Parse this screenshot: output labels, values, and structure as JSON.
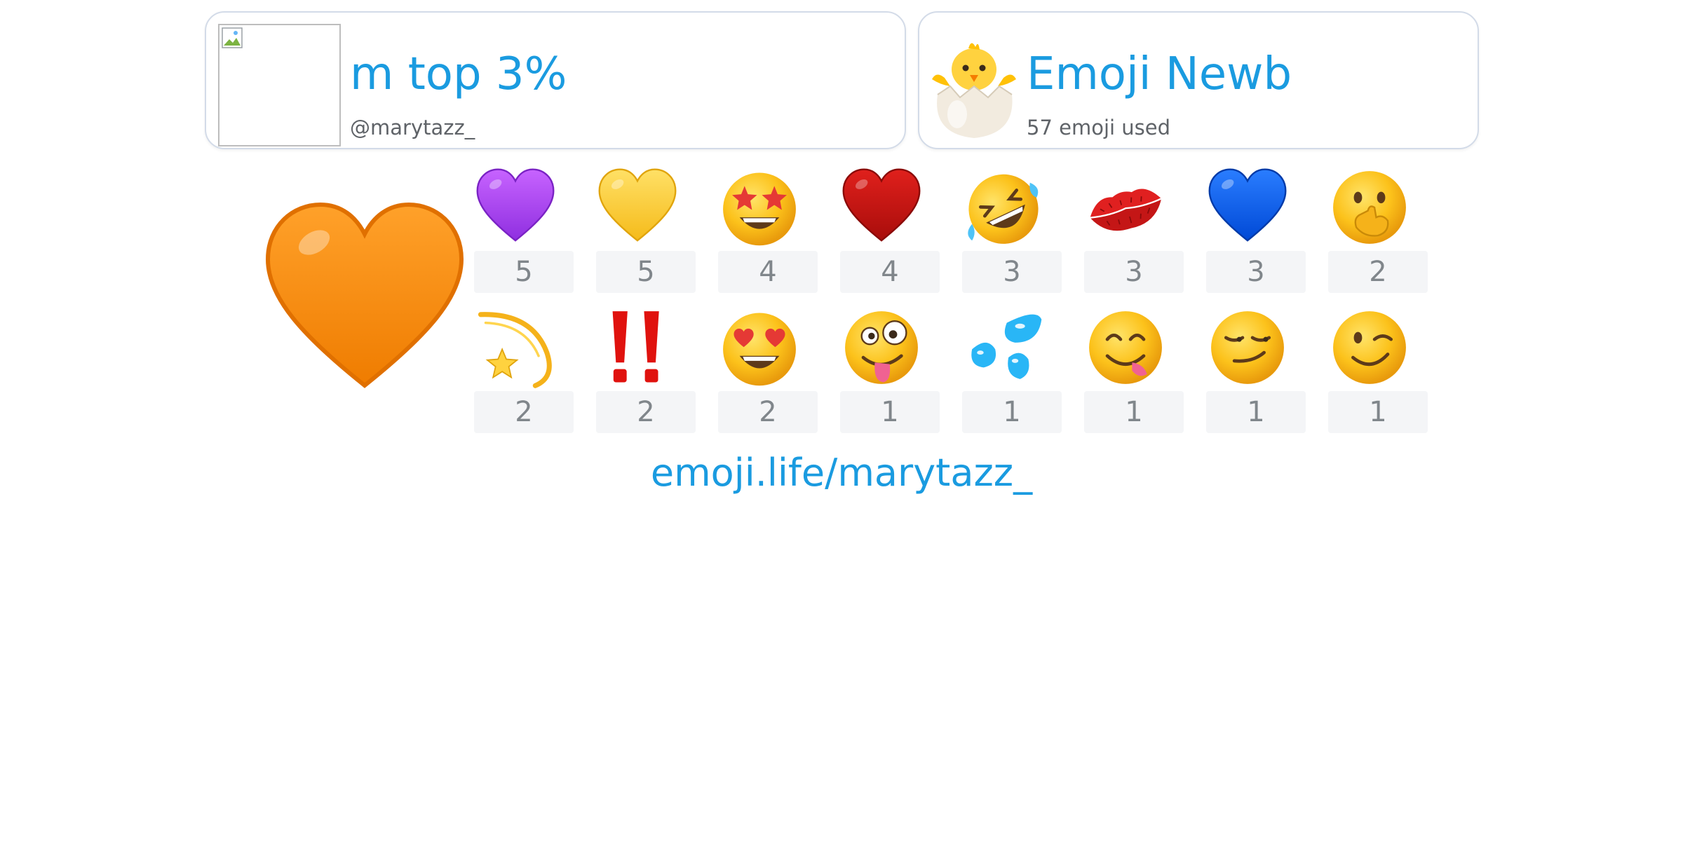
{
  "profile_card": {
    "rank_title": "m top 3%",
    "handle": "@marytazz_"
  },
  "badge_card": {
    "badge_title": "Emoji Newb",
    "badge_icon": "hatching-chick-icon",
    "usage_text": "57 emoji used"
  },
  "top_emoji": {
    "icon": "orange-heart-icon",
    "color": "#f5880e"
  },
  "emoji_stats": [
    {
      "icon": "purple-heart-icon",
      "count": "5"
    },
    {
      "icon": "yellow-heart-icon",
      "count": "5"
    },
    {
      "icon": "star-struck-face-icon",
      "count": "4"
    },
    {
      "icon": "red-heart-icon",
      "count": "4"
    },
    {
      "icon": "rolling-on-floor-laughing-icon",
      "count": "3"
    },
    {
      "icon": "kiss-mark-icon",
      "count": "3"
    },
    {
      "icon": "blue-heart-icon",
      "count": "3"
    },
    {
      "icon": "face-with-hand-over-mouth-icon",
      "count": "2"
    },
    {
      "icon": "dizzy-icon",
      "count": "2"
    },
    {
      "icon": "double-exclamation-icon",
      "count": "2"
    },
    {
      "icon": "heart-eyes-face-icon",
      "count": "2"
    },
    {
      "icon": "zany-face-icon",
      "count": "1"
    },
    {
      "icon": "sweat-droplets-icon",
      "count": "1"
    },
    {
      "icon": "face-savoring-food-icon",
      "count": "1"
    },
    {
      "icon": "smirking-face-icon",
      "count": "1"
    },
    {
      "icon": "winking-face-icon",
      "count": "1"
    }
  ],
  "footer": {
    "profile_url": "emoji.life/marytazz_"
  },
  "colors": {
    "accent": "#1a9be0",
    "muted_text": "#5f6368",
    "count_text": "#80868b",
    "count_bg": "#f4f5f7",
    "card_border": "#d3dbe8"
  }
}
